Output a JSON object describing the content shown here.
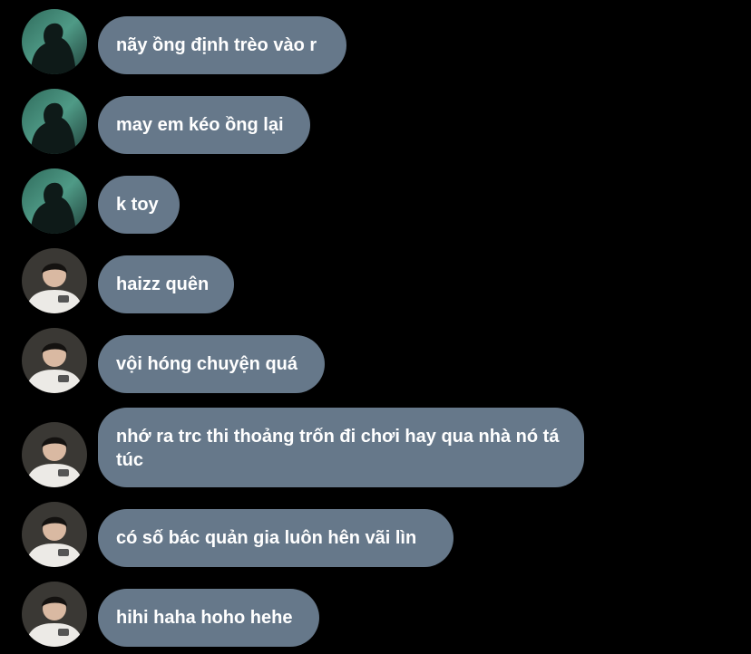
{
  "messages": [
    {
      "text": "nãy ồng định trèo vào r",
      "avatar": "avatar-sea-silhouette"
    },
    {
      "text": "may em kéo ồng lại",
      "avatar": "avatar-sea-silhouette"
    },
    {
      "text": "k toy",
      "avatar": "avatar-sea-silhouette"
    },
    {
      "text": "haizz quên",
      "avatar": "avatar-boy-white-shirt"
    },
    {
      "text": "vội hóng chuyện quá",
      "avatar": "avatar-boy-white-shirt"
    },
    {
      "text": "nhớ ra trc thi thoảng trốn đi chơi hay qua nhà nó tá túc",
      "avatar": "avatar-boy-white-shirt"
    },
    {
      "text": "có số bác quản gia luôn hên vãi lìn",
      "avatar": "avatar-boy-white-shirt"
    },
    {
      "text": "hihi haha hoho hehe",
      "avatar": "avatar-boy-white-shirt"
    }
  ],
  "colors": {
    "background": "#000000",
    "bubble": "#66788a",
    "text": "#ffffff"
  }
}
